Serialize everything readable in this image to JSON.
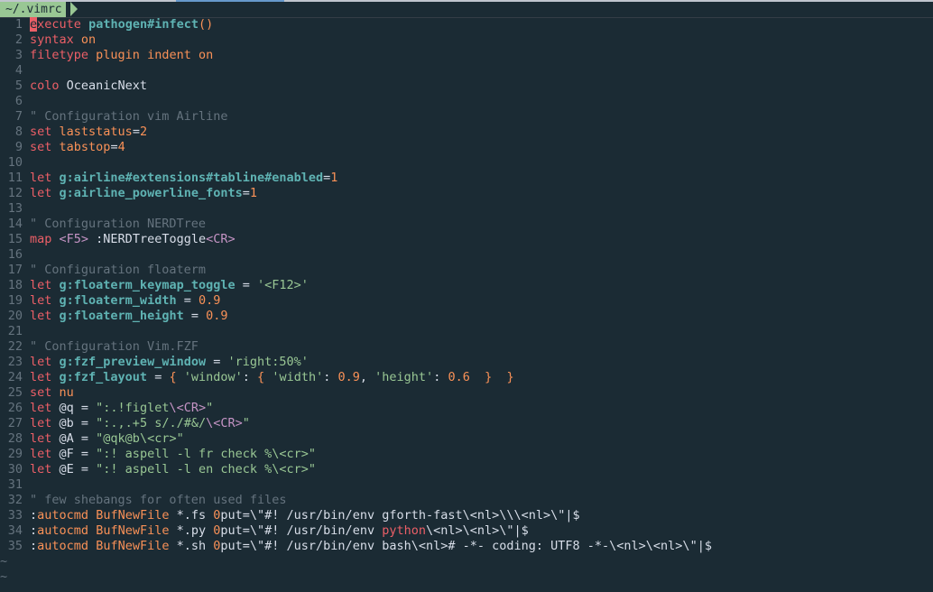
{
  "tab": {
    "title": "~/.vimrc"
  },
  "lines": [
    {
      "n": "1",
      "segs": [
        [
          "cursor",
          "e"
        ],
        [
          "kw",
          "xecute"
        ],
        [
          "plain",
          " "
        ],
        [
          "idb",
          "pathogen#infect"
        ],
        [
          "br",
          "()"
        ]
      ]
    },
    {
      "n": "2",
      "segs": [
        [
          "kw",
          "syntax"
        ],
        [
          "plain",
          " "
        ],
        [
          "kw2",
          "on"
        ]
      ]
    },
    {
      "n": "3",
      "segs": [
        [
          "kw",
          "filetype"
        ],
        [
          "plain",
          " "
        ],
        [
          "kw2",
          "plugin indent on"
        ]
      ]
    },
    {
      "n": "4",
      "segs": []
    },
    {
      "n": "5",
      "segs": [
        [
          "kw",
          "colo"
        ],
        [
          "plain",
          " OceanicNext"
        ]
      ]
    },
    {
      "n": "6",
      "segs": []
    },
    {
      "n": "7",
      "segs": [
        [
          "com",
          "\" Configuration vim Airline"
        ]
      ]
    },
    {
      "n": "8",
      "segs": [
        [
          "kw",
          "set"
        ],
        [
          "plain",
          " "
        ],
        [
          "kw2",
          "laststatus"
        ],
        [
          "plain",
          "="
        ],
        [
          "num",
          "2"
        ]
      ]
    },
    {
      "n": "9",
      "segs": [
        [
          "kw",
          "set"
        ],
        [
          "plain",
          " "
        ],
        [
          "kw2",
          "tabstop"
        ],
        [
          "plain",
          "="
        ],
        [
          "num",
          "4"
        ]
      ]
    },
    {
      "n": "10",
      "segs": []
    },
    {
      "n": "11",
      "segs": [
        [
          "kw",
          "let"
        ],
        [
          "plain",
          " "
        ],
        [
          "idb",
          "g:airline#extensions#tabline#enabled"
        ],
        [
          "plain",
          "="
        ],
        [
          "num",
          "1"
        ]
      ]
    },
    {
      "n": "12",
      "segs": [
        [
          "kw",
          "let"
        ],
        [
          "plain",
          " "
        ],
        [
          "idb",
          "g:airline_powerline_fonts"
        ],
        [
          "plain",
          "="
        ],
        [
          "num",
          "1"
        ]
      ]
    },
    {
      "n": "13",
      "segs": []
    },
    {
      "n": "14",
      "segs": [
        [
          "com",
          "\" Configuration NERDTree"
        ]
      ]
    },
    {
      "n": "15",
      "segs": [
        [
          "kw",
          "map"
        ],
        [
          "plain",
          " "
        ],
        [
          "fg",
          "<F5>"
        ],
        [
          "plain",
          " :NERDTreeToggle"
        ],
        [
          "fg",
          "<CR>"
        ]
      ]
    },
    {
      "n": "16",
      "segs": []
    },
    {
      "n": "17",
      "segs": [
        [
          "com",
          "\" Configuration floaterm"
        ]
      ]
    },
    {
      "n": "18",
      "segs": [
        [
          "kw",
          "let"
        ],
        [
          "plain",
          " "
        ],
        [
          "idb",
          "g:floaterm_keymap_toggle"
        ],
        [
          "plain",
          " = "
        ],
        [
          "str",
          "'<F12>'"
        ]
      ]
    },
    {
      "n": "19",
      "segs": [
        [
          "kw",
          "let"
        ],
        [
          "plain",
          " "
        ],
        [
          "idb",
          "g:floaterm_width"
        ],
        [
          "plain",
          " = "
        ],
        [
          "num",
          "0.9"
        ]
      ]
    },
    {
      "n": "20",
      "segs": [
        [
          "kw",
          "let"
        ],
        [
          "plain",
          " "
        ],
        [
          "idb",
          "g:floaterm_height"
        ],
        [
          "plain",
          " = "
        ],
        [
          "num",
          "0.9"
        ]
      ]
    },
    {
      "n": "21",
      "segs": []
    },
    {
      "n": "22",
      "segs": [
        [
          "com",
          "\" Configuration Vim.FZF"
        ]
      ]
    },
    {
      "n": "23",
      "segs": [
        [
          "kw",
          "let"
        ],
        [
          "plain",
          " "
        ],
        [
          "idb",
          "g:fzf_preview_window"
        ],
        [
          "plain",
          " = "
        ],
        [
          "str",
          "'right:50%'"
        ]
      ]
    },
    {
      "n": "24",
      "segs": [
        [
          "kw",
          "let"
        ],
        [
          "plain",
          " "
        ],
        [
          "idb",
          "g:fzf_layout"
        ],
        [
          "plain",
          " = "
        ],
        [
          "br",
          "{"
        ],
        [
          "plain",
          " "
        ],
        [
          "str",
          "'window'"
        ],
        [
          "plain",
          ": "
        ],
        [
          "br",
          "{"
        ],
        [
          "plain",
          " "
        ],
        [
          "str",
          "'width'"
        ],
        [
          "plain",
          ": "
        ],
        [
          "num",
          "0.9"
        ],
        [
          "plain",
          ", "
        ],
        [
          "str",
          "'height'"
        ],
        [
          "plain",
          ": "
        ],
        [
          "num",
          "0.6"
        ],
        [
          "plain",
          "  "
        ],
        [
          "br",
          "}"
        ],
        [
          "plain",
          "  "
        ],
        [
          "br",
          "}"
        ]
      ]
    },
    {
      "n": "25",
      "segs": [
        [
          "kw",
          "set"
        ],
        [
          "plain",
          " "
        ],
        [
          "kw2",
          "nu"
        ]
      ]
    },
    {
      "n": "26",
      "segs": [
        [
          "kw",
          "let"
        ],
        [
          "plain",
          " @q = "
        ],
        [
          "str",
          "\":.!figlet"
        ],
        [
          "fg",
          "\\<CR>"
        ],
        [
          "str",
          "\""
        ]
      ]
    },
    {
      "n": "27",
      "segs": [
        [
          "kw",
          "let"
        ],
        [
          "plain",
          " @b = "
        ],
        [
          "str",
          "\":.,.+5 s/./#&/"
        ],
        [
          "fg",
          "\\<CR>"
        ],
        [
          "str",
          "\""
        ]
      ]
    },
    {
      "n": "28",
      "segs": [
        [
          "kw",
          "let"
        ],
        [
          "plain",
          " @A = "
        ],
        [
          "str",
          "\"@qk@b\\<cr>\""
        ]
      ]
    },
    {
      "n": "29",
      "segs": [
        [
          "kw",
          "let"
        ],
        [
          "plain",
          " @F = "
        ],
        [
          "str",
          "\":! aspell -l fr check %\\<cr>\""
        ]
      ]
    },
    {
      "n": "30",
      "segs": [
        [
          "kw",
          "let"
        ],
        [
          "plain",
          " @E = "
        ],
        [
          "str",
          "\":! aspell -l en check %\\<cr>\""
        ]
      ]
    },
    {
      "n": "31",
      "segs": []
    },
    {
      "n": "32",
      "segs": [
        [
          "com",
          "\" few shebangs for often used files"
        ]
      ]
    },
    {
      "n": "33",
      "segs": [
        [
          "plain",
          ":"
        ],
        [
          "kw2",
          "autocmd"
        ],
        [
          "plain",
          " "
        ],
        [
          "kw2",
          "BufNewFile"
        ],
        [
          "plain",
          " *.fs "
        ],
        [
          "num",
          "0"
        ],
        [
          "plain",
          "put=\\\"#! /usr/bin/env gforth-fast\\<nl>\\\\\\<nl>\\\"|$"
        ]
      ]
    },
    {
      "n": "34",
      "segs": [
        [
          "plain",
          ":"
        ],
        [
          "kw2",
          "autocmd"
        ],
        [
          "plain",
          " "
        ],
        [
          "kw2",
          "BufNewFile"
        ],
        [
          "plain",
          " *.py "
        ],
        [
          "num",
          "0"
        ],
        [
          "plain",
          "put=\\\"#! /usr/bin/env "
        ],
        [
          "kw",
          "python"
        ],
        [
          "plain",
          "\\<nl>\\<nl>\\\"|$"
        ]
      ]
    },
    {
      "n": "35",
      "segs": [
        [
          "plain",
          ":"
        ],
        [
          "kw2",
          "autocmd"
        ],
        [
          "plain",
          " "
        ],
        [
          "kw2",
          "BufNewFile"
        ],
        [
          "plain",
          " *.sh "
        ],
        [
          "num",
          "0"
        ],
        [
          "plain",
          "put=\\\"#! /usr/bin/env bash\\<nl># -*- coding: UTF8 -*-\\<nl>\\<nl>\\\"|$"
        ]
      ]
    }
  ],
  "tildes": [
    "~",
    "~"
  ]
}
